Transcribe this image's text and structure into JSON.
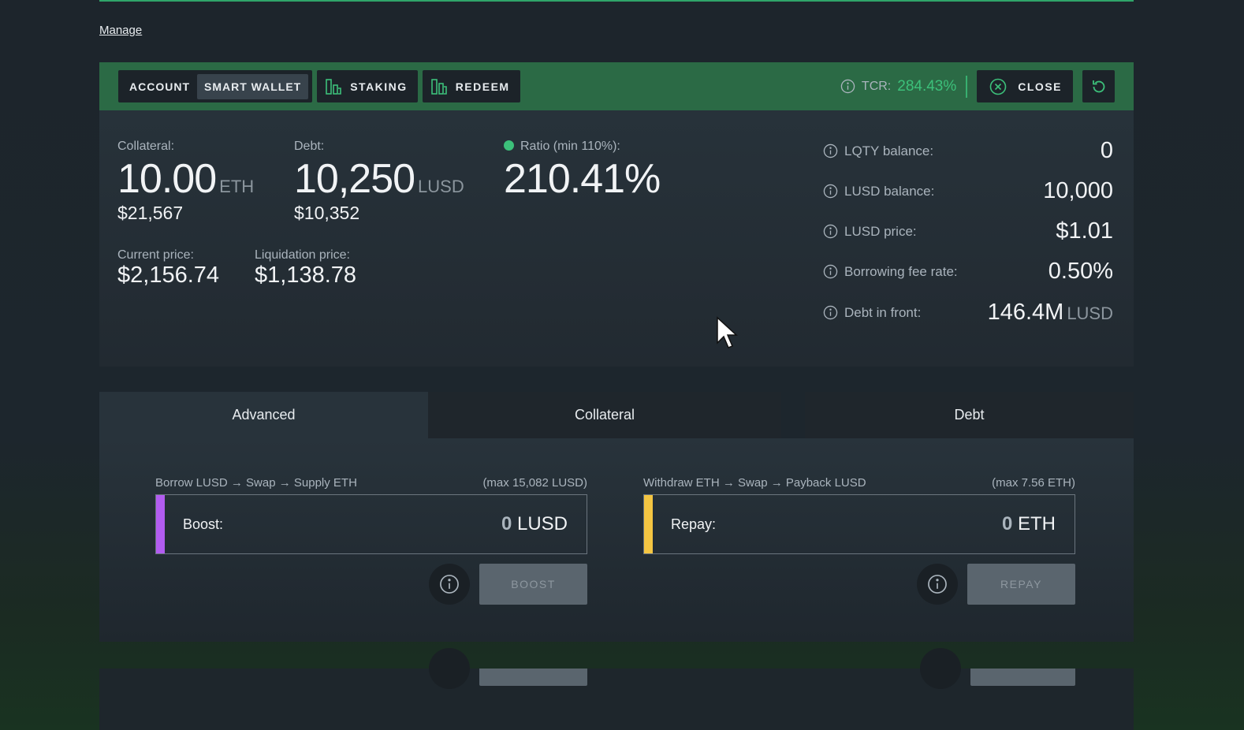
{
  "nav": {
    "manage_link": "Manage"
  },
  "toolbar": {
    "account": "ACCOUNT",
    "smart_wallet": "SMART WALLET",
    "staking": "STAKING",
    "redeem": "REDEEM",
    "tcr_label": "TCR:",
    "tcr_value": "284.43%",
    "close": "CLOSE",
    "accent_color": "#3cc07a",
    "bar_color": "#2b6a45"
  },
  "position": {
    "collateral_label": "Collateral:",
    "collateral_value": "10.00",
    "collateral_unit": "ETH",
    "collateral_usd": "$21,567",
    "debt_label": "Debt:",
    "debt_value": "10,250",
    "debt_unit": "LUSD",
    "debt_usd": "$10,352",
    "ratio_label": "Ratio (min 110%):",
    "ratio_value": "210.41%",
    "current_price_label": "Current price:",
    "current_price": "$2,156.74",
    "liquidation_price_label": "Liquidation price:",
    "liquidation_price": "$1,138.78"
  },
  "info": [
    {
      "label": "LQTY balance:",
      "value": "0",
      "unit": ""
    },
    {
      "label": "LUSD balance:",
      "value": "10,000",
      "unit": ""
    },
    {
      "label": "LUSD price:",
      "value": "$1.01",
      "unit": ""
    },
    {
      "label": "Borrowing fee rate:",
      "value": "0.50%",
      "unit": ""
    },
    {
      "label": "Debt in front:",
      "value": "146.4M",
      "unit": "LUSD"
    }
  ],
  "tabs": [
    "Advanced",
    "Collateral",
    "Debt"
  ],
  "boost": {
    "description": "Borrow LUSD → Swap → Supply ETH",
    "max": "(max 15,082 LUSD)",
    "label": "Boost:",
    "amount": "0",
    "unit": "LUSD",
    "button": "BOOST",
    "color": "#b25cf0"
  },
  "repay": {
    "description": "Withdraw ETH → Swap → Payback LUSD",
    "max": "(max 7.56 ETH)",
    "label": "Repay:",
    "amount": "0",
    "unit": "ETH",
    "button": "REPAY",
    "color": "#f4c542"
  }
}
